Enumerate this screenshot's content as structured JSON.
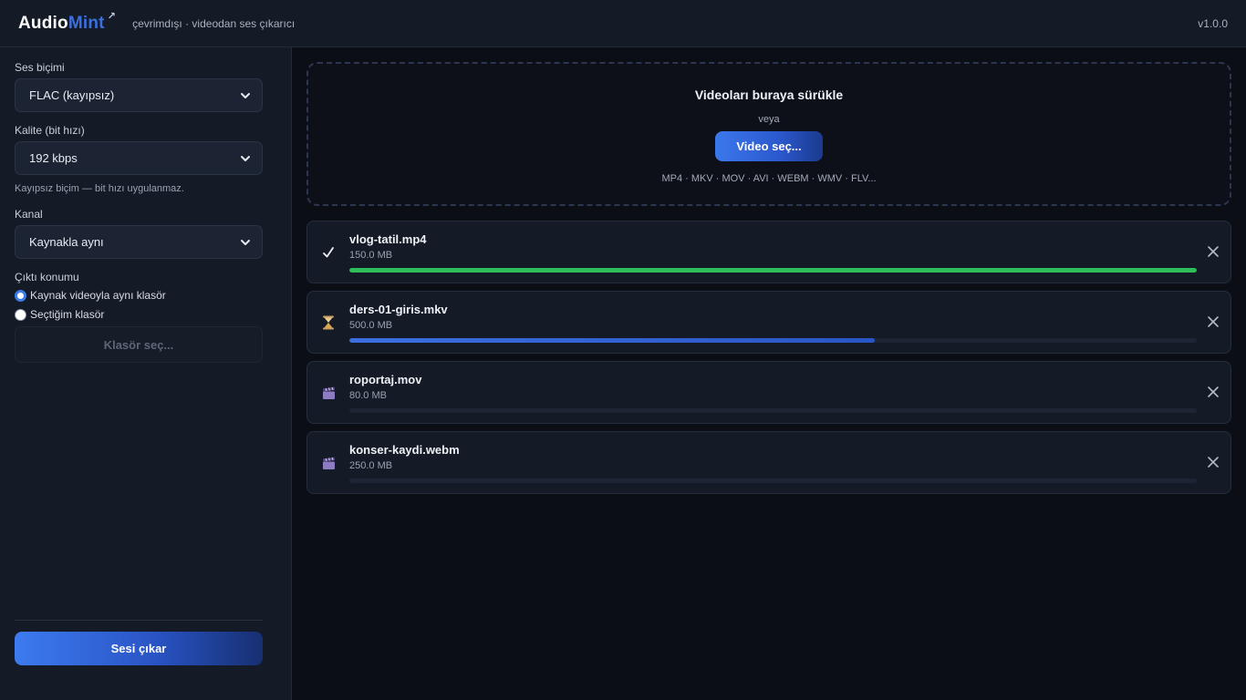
{
  "app": {
    "name_part1": "Audio",
    "name_part2": "Mint",
    "tagline": "çevrimdışı · videodan ses çıkarıcı",
    "version": "v1.0.0"
  },
  "sidebar": {
    "format_label": "Ses biçimi",
    "format_value": "FLAC (kayıpsız)",
    "quality_label": "Kalite (bit hızı)",
    "quality_value": "192 kbps",
    "quality_hint": "Kayıpsız biçim — bit hızı uygulanmaz.",
    "channel_label": "Kanal",
    "channel_value": "Kaynakla aynı",
    "output_label": "Çıktı konumu",
    "output_option_same": "Kaynak videoyla aynı klasör",
    "output_option_custom": "Seçtiğim klasör",
    "output_selected": "same",
    "choose_folder": "Klasör seç...",
    "extract_button": "Sesi çıkar"
  },
  "dropzone": {
    "title": "Videoları buraya sürükle",
    "or": "veya",
    "button": "Video seç...",
    "formats": "MP4 · MKV · MOV · AVI · WEBM · WMV · FLV..."
  },
  "files": [
    {
      "name": "vlog-tatil.mp4",
      "size": "150.0 MB",
      "status": "done",
      "icon": "check-icon",
      "progress": 1.0,
      "color": "#2fbf5a"
    },
    {
      "name": "ders-01-giris.mkv",
      "size": "500.0 MB",
      "status": "processing",
      "icon": "hourglass-icon",
      "progress": 0.62,
      "color": "#3b6fe0"
    },
    {
      "name": "roportaj.mov",
      "size": "80.0 MB",
      "status": "queued",
      "icon": "clapper-icon",
      "progress": 0,
      "color": "#3b6fe0"
    },
    {
      "name": "konser-kaydi.webm",
      "size": "250.0 MB",
      "status": "queued",
      "icon": "clapper-icon",
      "progress": 0,
      "color": "#3b6fe0"
    }
  ],
  "colors": {
    "accent": "#3b6fe0",
    "success": "#2fbf5a",
    "background": "#0b0e15",
    "panel": "#141a26"
  }
}
